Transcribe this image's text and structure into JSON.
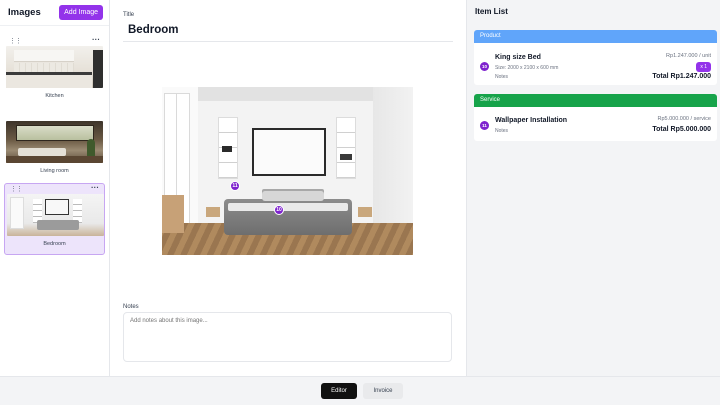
{
  "sidebar": {
    "title": "Images",
    "add_button": "Add Image",
    "images": [
      {
        "label": "Kitchen"
      },
      {
        "label": "Living room"
      },
      {
        "label": "Bedroom",
        "selected": true
      }
    ]
  },
  "editor": {
    "title_label": "Title",
    "title_value": "Bedroom",
    "markers": [
      {
        "number": "11"
      },
      {
        "number": "10"
      }
    ],
    "notes_label": "Notes",
    "notes_placeholder": "Add notes about this image..."
  },
  "item_list": {
    "title": "Item List",
    "sections": [
      {
        "name": "Product",
        "color": "#60a5fa",
        "items": [
          {
            "badge": "10",
            "name": "King size Bed",
            "size": "Size: 2000 x 2100 x 600 mm",
            "notes": "Notes",
            "unit_price": "Rp1.247.000 / unit",
            "quantity": "x 1",
            "total": "Total Rp1.247.000"
          }
        ]
      },
      {
        "name": "Service",
        "color": "#16a34a",
        "items": [
          {
            "badge": "11",
            "name": "Wallpaper Installation",
            "notes": "Notes",
            "unit_price": "Rp5.000.000 / service",
            "total": "Total Rp5.000.000"
          }
        ]
      }
    ]
  },
  "bottom_tabs": [
    {
      "label": "Editor",
      "active": true
    },
    {
      "label": "Invoice",
      "active": false
    }
  ],
  "colors": {
    "accent_purple": "#9333ea",
    "marker_purple": "#7e22ce",
    "product_blue": "#60a5fa",
    "service_green": "#16a34a"
  }
}
